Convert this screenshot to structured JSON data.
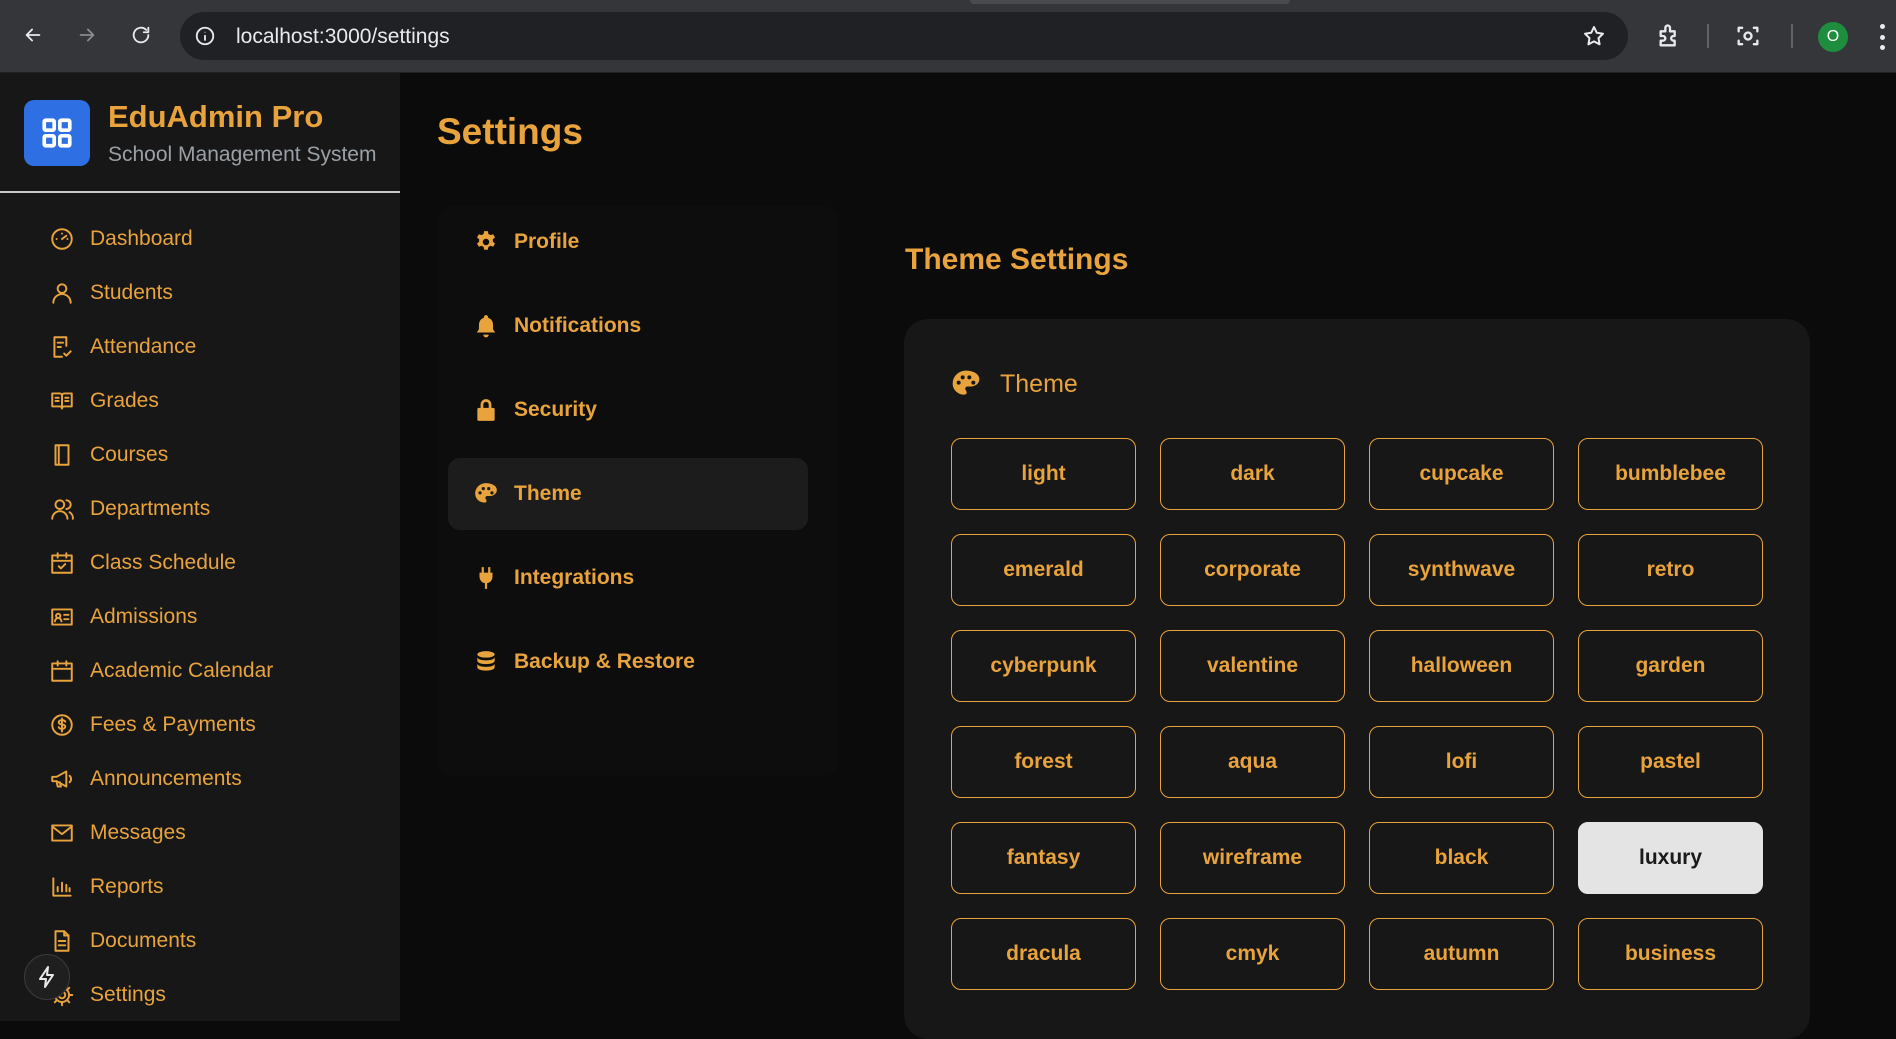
{
  "browser": {
    "url": "localhost:3000/settings",
    "profile_initial": "O"
  },
  "sidebar": {
    "app_title": "EduAdmin Pro",
    "app_subtitle": "School Management System",
    "items": [
      {
        "label": "Dashboard",
        "icon": "dashboard-icon"
      },
      {
        "label": "Students",
        "icon": "user-icon"
      },
      {
        "label": "Attendance",
        "icon": "attendance-icon"
      },
      {
        "label": "Grades",
        "icon": "book-open-icon"
      },
      {
        "label": "Courses",
        "icon": "book-icon"
      },
      {
        "label": "Departments",
        "icon": "users-icon"
      },
      {
        "label": "Class Schedule",
        "icon": "calendar-check-icon"
      },
      {
        "label": "Admissions",
        "icon": "id-card-icon"
      },
      {
        "label": "Academic Calendar",
        "icon": "calendar-icon"
      },
      {
        "label": "Fees & Payments",
        "icon": "dollar-circle-icon"
      },
      {
        "label": "Announcements",
        "icon": "megaphone-icon"
      },
      {
        "label": "Messages",
        "icon": "mail-icon"
      },
      {
        "label": "Reports",
        "icon": "bar-chart-icon"
      },
      {
        "label": "Documents",
        "icon": "document-icon"
      },
      {
        "label": "Settings",
        "icon": "gear-icon"
      }
    ]
  },
  "main": {
    "page_title": "Settings",
    "settings_nav": [
      {
        "label": "Profile",
        "icon": "gear-icon"
      },
      {
        "label": "Notifications",
        "icon": "bell-icon"
      },
      {
        "label": "Security",
        "icon": "lock-icon"
      },
      {
        "label": "Theme",
        "icon": "palette-icon",
        "active": true
      },
      {
        "label": "Integrations",
        "icon": "plug-icon"
      },
      {
        "label": "Backup & Restore",
        "icon": "database-icon"
      }
    ],
    "section_title": "Theme Settings",
    "card_title": "Theme",
    "themes": [
      "light",
      "dark",
      "cupcake",
      "bumblebee",
      "emerald",
      "corporate",
      "synthwave",
      "retro",
      "cyberpunk",
      "valentine",
      "halloween",
      "garden",
      "forest",
      "aqua",
      "lofi",
      "pastel",
      "fantasy",
      "wireframe",
      "black",
      "luxury",
      "dracula",
      "cmyk",
      "autumn",
      "business"
    ],
    "selected_theme": "luxury"
  },
  "colors": {
    "accent": "#e8a33d",
    "sidebar_bg": "#171717",
    "page_bg": "#0b0b0b",
    "logo_bg": "#2f6fe4",
    "selected_bg": "#e4e4e4"
  }
}
